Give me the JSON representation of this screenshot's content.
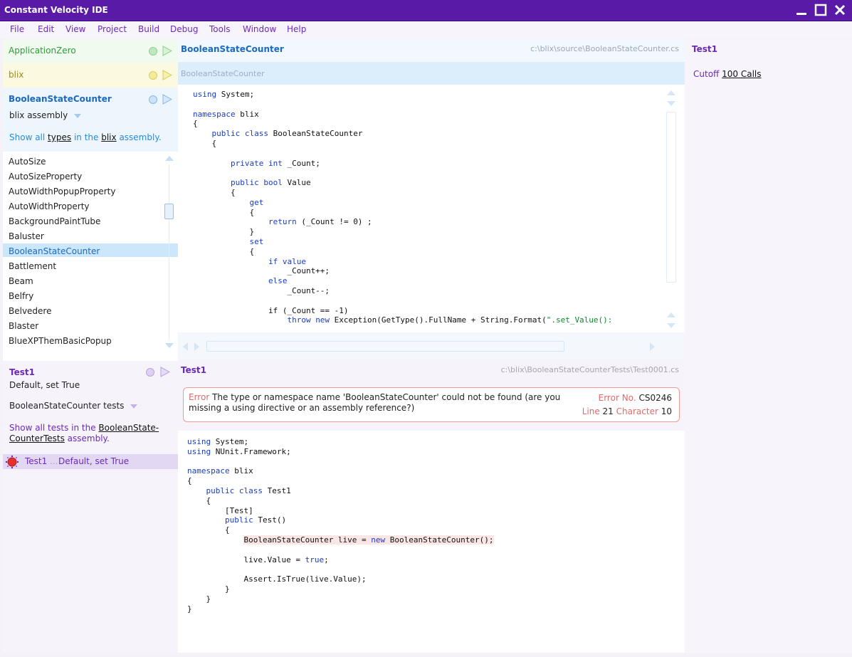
{
  "window": {
    "title": "Constant Velocity IDE"
  },
  "menu": [
    "File",
    "Edit",
    "View",
    "Project",
    "Build",
    "Debug",
    "Tools",
    "Window",
    "Help"
  ],
  "projects": [
    {
      "name": "ApplicationZero",
      "color": "#2e9a3a",
      "bg": "#f0faef"
    },
    {
      "name": "blix",
      "color": "#9a8a10",
      "bg": "#fbfae0"
    },
    {
      "name": "BooleanStateCounter",
      "color": "#1a6ac0",
      "bg": "#eef6fd"
    }
  ],
  "assembly": {
    "selector_label": "blix assembly",
    "show_all_prefix": "Show all",
    "show_all_link1": "types",
    "show_all_mid": "in the",
    "show_all_link2": "blix",
    "show_all_suffix": "assembly."
  },
  "types": [
    "AutoSize",
    "AutoSizeProperty",
    "AutoWidthPopupProperty",
    "AutoWidthProperty",
    "BackgroundPaintTube",
    "Baluster",
    "BooleanStateCounter",
    "Battlement",
    "Beam",
    "Belfry",
    "Belvedere",
    "Blaster",
    "BlueXPThemBasicPopup"
  ],
  "selected_type": "BooleanStateCounter",
  "test_panel": {
    "title": "Test1",
    "subtitle": "Default, set True",
    "selector_label": "BooleanStateCounter tests",
    "show_all_prefix": "Show all tests in the",
    "show_all_link": "BooleanState-CounterTests",
    "show_all_suffix": "assembly.",
    "result_name": "Test1",
    "result_sep": "...",
    "result_desc": "Default, set True"
  },
  "editor_top": {
    "title": "BooleanStateCounter",
    "path": "c:\\blix\\source\\BooleanStateCounter.cs",
    "breadcrumb": "BooleanStateCounter"
  },
  "editor_bottom": {
    "title": "Test1",
    "path": "c:\\blix\\BooleanStateCounterTests\\Test0001.cs",
    "error_label": "Error",
    "error_message": "The type or namespace name 'BooleanStateCounter' could not be found (are you missing a using directive or an assembly reference?)",
    "error_no_label": "Error No.",
    "error_no": "CS0246",
    "line_label": "Line",
    "line": "21",
    "char_label": "Character",
    "char": "10"
  },
  "right_panel": {
    "title": "Test1",
    "cutoff_label": "Cutoff",
    "cutoff_value": "100 Calls"
  },
  "colors": {
    "accent": "#6a2ab8",
    "error": "#d04040",
    "keyword": "#1a3cc8",
    "selection": "#cce6fb"
  }
}
